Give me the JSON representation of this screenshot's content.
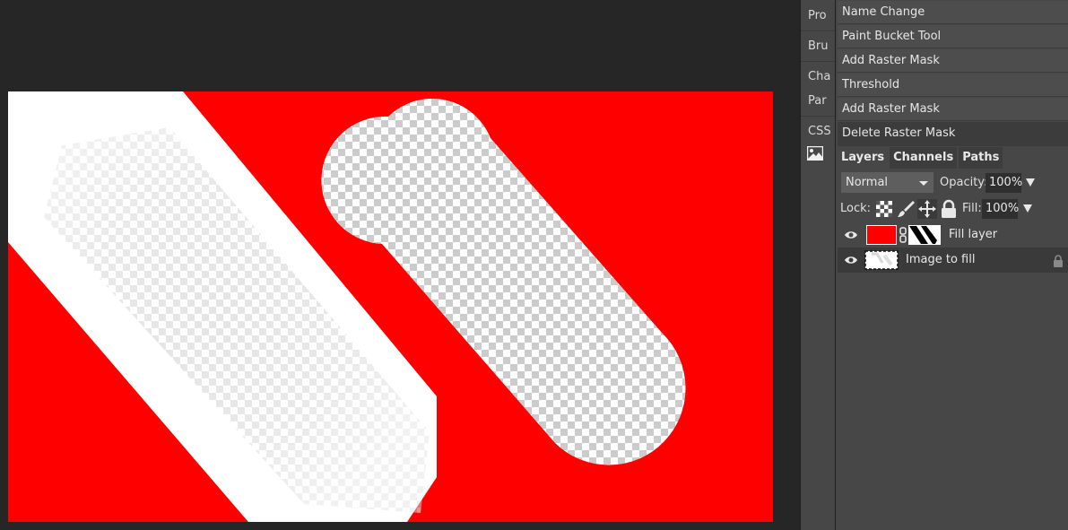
{
  "sidebar_tabs": [
    {
      "id": "properties",
      "label": "Pro"
    },
    {
      "id": "brushes",
      "label": "Bru"
    },
    {
      "id": "characters",
      "label": "Cha"
    },
    {
      "id": "paragraphs",
      "label": "Par"
    },
    {
      "id": "css",
      "label": "CSS"
    }
  ],
  "sidebar_image_icon": "image-icon",
  "history": [
    "Name Change",
    "Paint Bucket Tool",
    "Add Raster Mask",
    "Threshold",
    "Add Raster Mask",
    "Delete Raster Mask"
  ],
  "panel_tabs": [
    "Layers",
    "Channels",
    "Paths"
  ],
  "blend_mode": "Normal",
  "opacity_label": "Opacity:",
  "opacity_value": "100%",
  "lock_label": "Lock:",
  "fill_label": "Fill:",
  "fill_value": "100%",
  "layers": [
    {
      "name": "Fill layer",
      "visible": true,
      "locked": false,
      "selected": false
    },
    {
      "name": "Image to fill",
      "visible": true,
      "locked": true,
      "selected": true
    }
  ],
  "colors": {
    "fill": "#ff0000",
    "background": "#262626",
    "panel": "#474747"
  }
}
